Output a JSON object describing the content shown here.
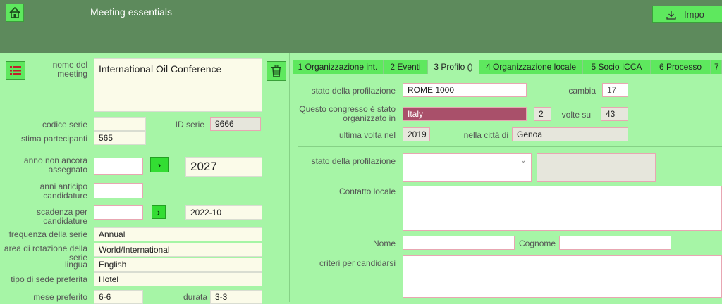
{
  "header": {
    "title": "Meeting essentials",
    "import_label": "Impo"
  },
  "icons": {
    "home": "home-icon",
    "list": "list-icon",
    "trash": "trash-icon",
    "download": "download-icon",
    "go": "chevron-right-icon"
  },
  "left": {
    "meeting_name_label": "nome del meeting",
    "meeting_name_value": "International Oil Conference",
    "series_code_label": "codice serie",
    "series_code_value": "",
    "series_id_label": "ID serie",
    "series_id_value": "9666",
    "est_participants_label": "stima partecipanti",
    "est_participants_value": "565",
    "unassigned_year_label": "anno non ancora assegnato",
    "unassigned_year_value": "",
    "year_big_value": "2027",
    "lead_years_label": "anni anticipo candidature",
    "lead_years_value": "",
    "deadline_label": "scadenza per candidature",
    "deadline_value": "",
    "deadline_result": "2022-10",
    "frequency_label": "frequenza della serie",
    "frequency_value": "Annual",
    "rotation_label": "area di rotazione della serie",
    "rotation_value": "World/International",
    "language_label": "lingua",
    "language_value": "English",
    "venue_label": "tipo di sede preferita",
    "venue_value": "Hotel",
    "month_label": "mese preferito",
    "month_value": "6-6",
    "duration_label": "durata",
    "duration_value": "3-3"
  },
  "tabs": [
    {
      "label": "1 Organizzazione int.",
      "active": false
    },
    {
      "label": "2 Eventi",
      "active": false
    },
    {
      "label": "3 Profilo ()",
      "active": true
    },
    {
      "label": "4 Organizzazione locale",
      "active": false
    },
    {
      "label": "5 Socio ICCA",
      "active": false
    },
    {
      "label": "6 Processo",
      "active": false
    },
    {
      "label": "7",
      "active": false
    }
  ],
  "profile": {
    "status_label": "stato della profilazione",
    "status_value": "ROME 1000",
    "change_label": "cambia",
    "change_value": "17",
    "organized_in_label": "Questo congresso è stato organizzato in",
    "organized_in_country": "Italy",
    "times_value": "2",
    "times_of_label": "volte su",
    "times_total": "43",
    "last_time_label": "ultima volta nel",
    "last_time_value": "2019",
    "city_label": "nella città di",
    "city_value": "Genoa",
    "status2_label": "stato della profilazione",
    "status2_value": "",
    "contact_label": "Contatto locale",
    "contact_value": "",
    "first_name_label": "Nome",
    "first_name_value": "",
    "last_name_label": "Cognome",
    "last_name_value": "",
    "criteria_label": "criteri per candidarsi",
    "criteria_value": ""
  }
}
